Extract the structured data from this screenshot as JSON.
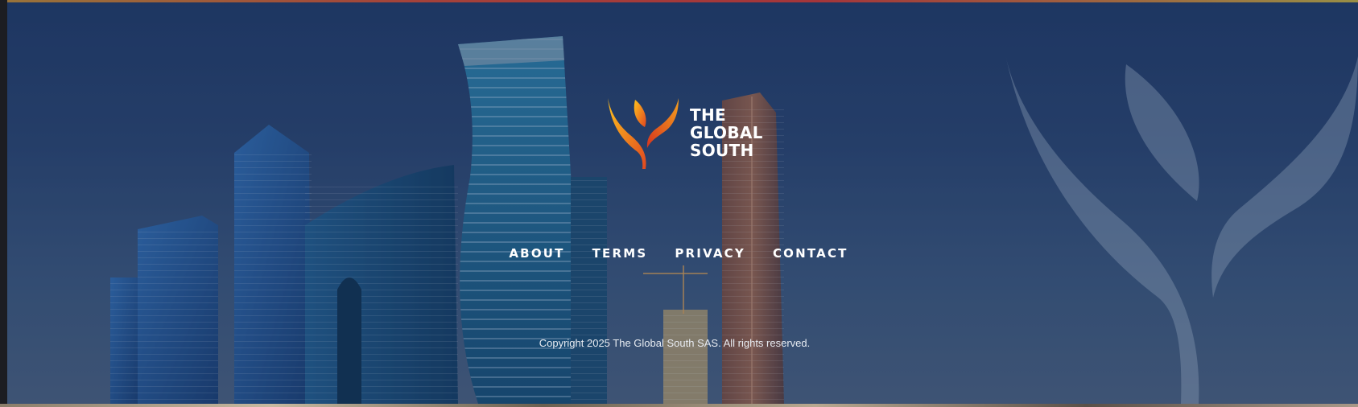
{
  "brand": {
    "logo_icon": "flame-leaf-icon",
    "name_lines": [
      "THE",
      "GLOBAL",
      "SOUTH"
    ],
    "accent_colors": [
      "#f5b21e",
      "#e8521f",
      "#d63b1e"
    ]
  },
  "nav": {
    "items": [
      {
        "label": "ABOUT"
      },
      {
        "label": "TERMS"
      },
      {
        "label": "PRIVACY"
      },
      {
        "label": "CONTACT"
      }
    ]
  },
  "footer": {
    "copyright": "Copyright 2025 The Global South SAS. All rights reserved.",
    "background_color": "#1d3561"
  }
}
